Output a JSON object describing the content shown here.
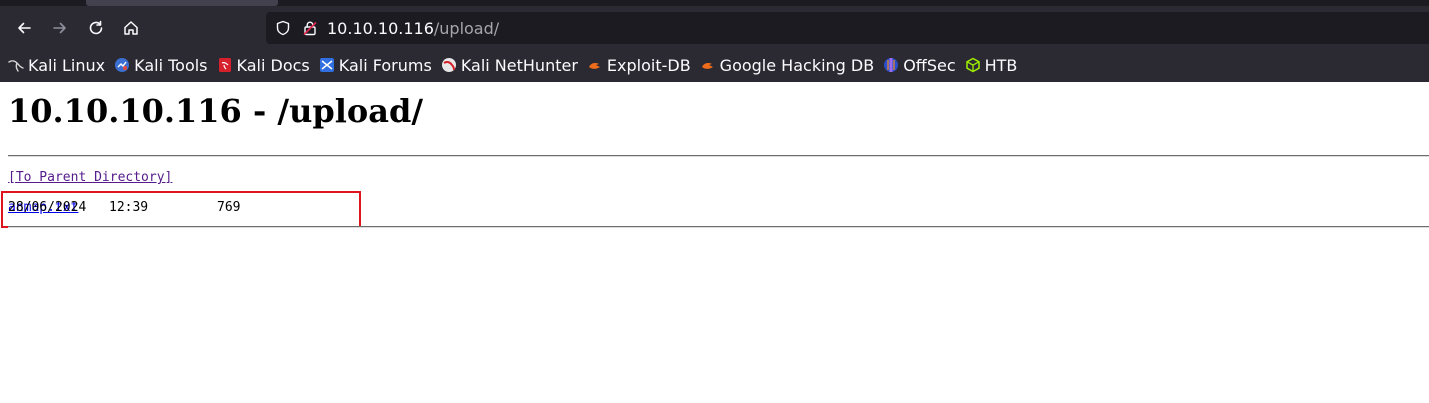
{
  "browser": {
    "url_host": "10.10.10.116",
    "url_path": "/upload/",
    "bookmarks": [
      {
        "label": "Kali Linux",
        "icon": "kali-dragon-icon"
      },
      {
        "label": "Kali Tools",
        "icon": "kali-tools-icon"
      },
      {
        "label": "Kali Docs",
        "icon": "kali-docs-icon"
      },
      {
        "label": "Kali Forums",
        "icon": "kali-forums-icon"
      },
      {
        "label": "Kali NetHunter",
        "icon": "kali-nethunter-icon"
      },
      {
        "label": "Exploit-DB",
        "icon": "exploit-db-icon"
      },
      {
        "label": "Google Hacking DB",
        "icon": "google-hacking-db-icon"
      },
      {
        "label": "OffSec",
        "icon": "offsec-icon"
      },
      {
        "label": "HTB",
        "icon": "htb-icon"
      }
    ]
  },
  "page": {
    "title": "10.10.10.116 - /upload/",
    "parent_link": "[To Parent Directory]",
    "entries": [
      {
        "date": "28/06/2024",
        "time": "12:39",
        "size": "769",
        "name": "anmap.txt"
      }
    ]
  },
  "colors": {
    "chrome_bg": "#2b2a33",
    "urlbar_bg": "#1c1b22",
    "visited_link": "#551a8b",
    "link": "#0000ee",
    "highlight": "#e0141e"
  }
}
